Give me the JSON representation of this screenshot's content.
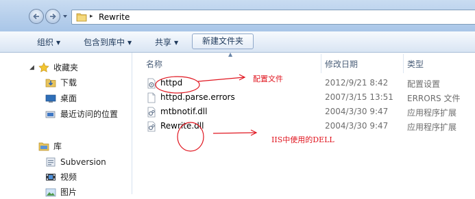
{
  "address": {
    "path": "Rewrite"
  },
  "toolbar": {
    "organize": "组织",
    "include_library": "包含到库中",
    "share": "共享",
    "new_folder": "新建文件夹"
  },
  "navpane": {
    "favorites": "收藏夹",
    "downloads": "下载",
    "desktop": "桌面",
    "recent": "最近访问的位置",
    "libraries": "库",
    "subversion": "Subversion",
    "videos": "视频",
    "pictures": "图片"
  },
  "columns": {
    "name": "名称",
    "date": "修改日期",
    "type": "类型"
  },
  "files": [
    {
      "name": "httpd",
      "date": "2012/9/21 8:42",
      "type": "配置设置",
      "icon": "config-file-icon"
    },
    {
      "name": "httpd.parse.errors",
      "date": "2007/3/15 13:51",
      "type": "ERRORS 文件",
      "icon": "blank-file-icon"
    },
    {
      "name": "mtbnotif.dll",
      "date": "2004/3/30 9:47",
      "type": "应用程序扩展",
      "icon": "dll-file-icon"
    },
    {
      "name": "Rewrite.dll",
      "date": "2004/3/30 9:47",
      "type": "应用程序扩展",
      "icon": "dll-file-icon"
    }
  ],
  "annotations": {
    "config_note": "配置文件",
    "dll_note": "IIS中使用的DELL",
    "color": "#e0141e"
  }
}
